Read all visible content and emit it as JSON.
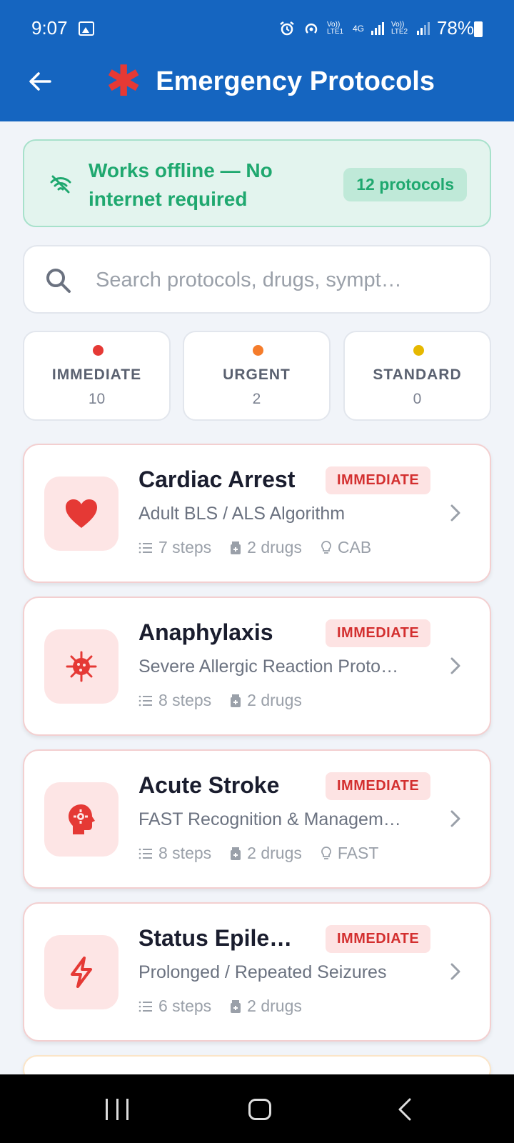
{
  "status_bar": {
    "time": "9:07",
    "network_1": "Vo)) LTE1",
    "network_type": "4G",
    "network_2": "Vo)) LTE2",
    "battery": "78%"
  },
  "app_bar": {
    "title": "Emergency Protocols",
    "back_icon": "arrow-left-icon",
    "title_icon": "asterisk-icon"
  },
  "offline_banner": {
    "message": "Works offline — No internet required",
    "count_badge": "12 protocols",
    "icon": "wifi-off-icon"
  },
  "search": {
    "placeholder": "Search protocols, drugs, sympt…",
    "value": ""
  },
  "filters": [
    {
      "label": "IMMEDIATE",
      "count": "10",
      "color": "#e53935"
    },
    {
      "label": "URGENT",
      "count": "2",
      "color": "#f57c2b"
    },
    {
      "label": "STANDARD",
      "count": "0",
      "color": "#e6b800"
    }
  ],
  "protocols": [
    {
      "name": "Cardiac Arrest",
      "priority": "IMMEDIATE",
      "subtitle": "Adult BLS / ALS Algorithm",
      "steps": "7 steps",
      "drugs": "2 drugs",
      "mnemonic": "CAB",
      "icon": "heart-icon"
    },
    {
      "name": "Anaphylaxis",
      "priority": "IMMEDIATE",
      "subtitle": "Severe Allergic Reaction Proto…",
      "steps": "8 steps",
      "drugs": "2 drugs",
      "mnemonic": "",
      "icon": "virus-icon"
    },
    {
      "name": "Acute Stroke",
      "priority": "IMMEDIATE",
      "subtitle": "FAST Recognition & Managem…",
      "steps": "8 steps",
      "drugs": "2 drugs",
      "mnemonic": "FAST",
      "icon": "brain-gear-icon"
    },
    {
      "name": "Status Epile…",
      "priority": "IMMEDIATE",
      "subtitle": "Prolonged / Repeated Seizures",
      "steps": "6 steps",
      "drugs": "2 drugs",
      "mnemonic": "",
      "icon": "lightning-icon"
    }
  ],
  "colors": {
    "primary": "#1565c0",
    "danger": "#d32f2f",
    "success": "#1fa86f"
  }
}
